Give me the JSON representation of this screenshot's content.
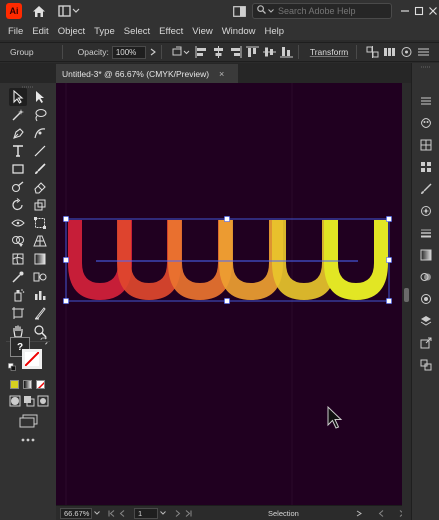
{
  "app": {
    "logo_text": "Ai"
  },
  "search": {
    "placeholder": "Search Adobe Help"
  },
  "menu": [
    "File",
    "Edit",
    "Object",
    "Type",
    "Select",
    "Effect",
    "View",
    "Window",
    "Help"
  ],
  "control_bar": {
    "selection_type": "Group",
    "opacity_label": "Opacity:",
    "opacity_value": "100%",
    "transform_label": "Transform"
  },
  "document_tab": {
    "title": "Untitled-3* @ 66.67% (CMYK/Preview)",
    "close": "×"
  },
  "status_bar": {
    "zoom": "66.67%",
    "artboard": "1",
    "tool": "Selection"
  },
  "tools_panel": {
    "default_fill_stroke": "?"
  },
  "colors": {
    "canvas": "#200020",
    "gradient_start": "#d8203a",
    "gradient_mid": "#f07a30",
    "gradient_end": "#e8ee20",
    "selection": "#4a68ff"
  },
  "icons": [
    "home-icon",
    "layout-icon",
    "search-icon",
    "minimize-icon",
    "restore-icon",
    "close-icon"
  ]
}
